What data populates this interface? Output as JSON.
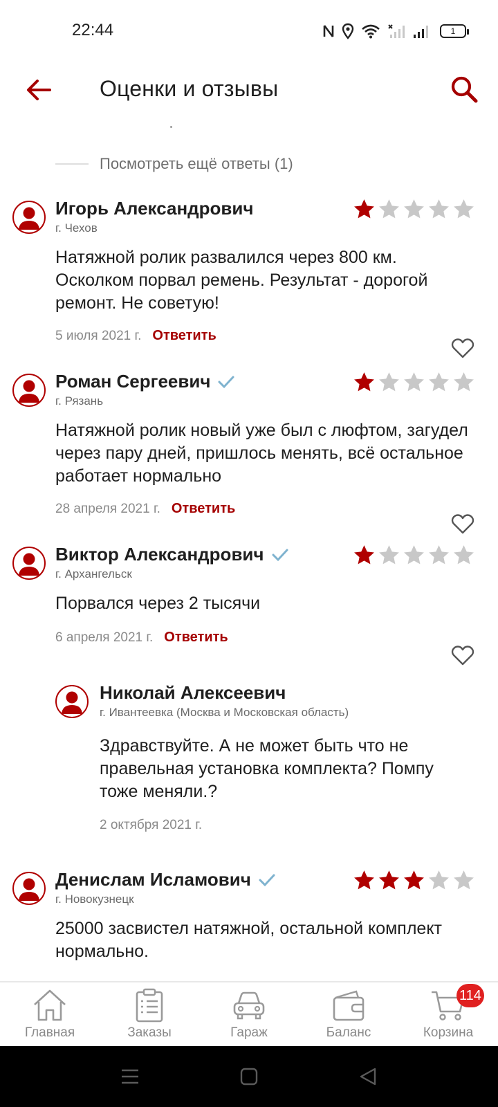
{
  "status_bar": {
    "time": "22:44",
    "battery_level": "1",
    "icons": [
      "nfc-icon",
      "location-icon",
      "wifi-icon",
      "signal-no-service-icon",
      "signal-icon",
      "battery-icon"
    ]
  },
  "header": {
    "title": "Оценки и отзывы",
    "back_icon": "arrow-left-icon",
    "search_icon": "search-icon"
  },
  "more_answers": "Посмотреть ещё ответы (1)",
  "reviews": [
    {
      "name": "Игорь Александрович",
      "verified": false,
      "city": "г. Чехов",
      "rating": 1,
      "text": "Натяжной ролик развалился через 800 км. Осколком порвал ремень. Результат - дорогой ремонт. Не советую!",
      "date": "5 июля 2021 г.",
      "reply": "Ответить"
    },
    {
      "name": "Роман Сергеевич",
      "verified": true,
      "city": "г. Рязань",
      "rating": 1,
      "text": "Натяжной ролик новый уже был с люфтом, загудел через пару дней, пришлось менять, всё остальное работает нормально",
      "date": "28 апреля 2021 г.",
      "reply": "Ответить"
    },
    {
      "name": "Виктор Александрович",
      "verified": true,
      "city": "г. Архангельск",
      "rating": 1,
      "text": "Порвался через 2 тысячи",
      "date": "6 апреля 2021 г.",
      "reply": "Ответить",
      "answer": {
        "name": "Николай Алексеевич",
        "city": "г. Ивантеевка (Москва и Московская область)",
        "text": "Здравствуйте. А не может быть что не правельная установка комплекта? Помпу тоже меняли.?",
        "date": "2 октября 2021 г."
      }
    },
    {
      "name": "Денислам Исламович",
      "verified": true,
      "city": "г. Новокузнецк",
      "rating": 3,
      "text": "25000 засвистел натяжной, остальной комплект нормально."
    }
  ],
  "colors": {
    "accent": "#a50000",
    "star_active": "#b00000",
    "star_inactive": "#c8c8c8",
    "verified": "#7fb3cf"
  },
  "bottom_nav": [
    {
      "label": "Главная",
      "icon": "home-icon"
    },
    {
      "label": "Заказы",
      "icon": "orders-icon"
    },
    {
      "label": "Гараж",
      "icon": "car-icon"
    },
    {
      "label": "Баланс",
      "icon": "wallet-icon"
    },
    {
      "label": "Корзина",
      "icon": "cart-icon",
      "badge": "114"
    }
  ],
  "system_nav": [
    "menu-icon",
    "home-square-icon",
    "back-triangle-icon"
  ]
}
